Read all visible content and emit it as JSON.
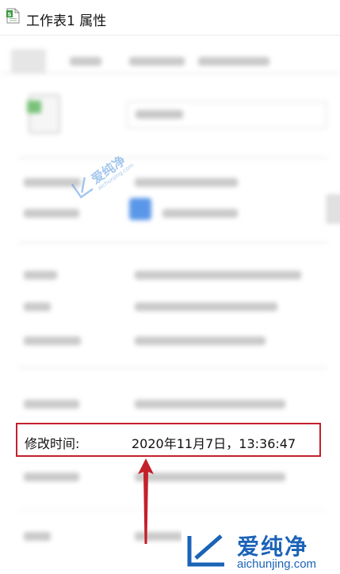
{
  "window": {
    "title": "工作表1 属性",
    "icon": "spreadsheet-file-icon"
  },
  "highlighted_row": {
    "label": "修改时间:",
    "value": "2020年11月7日，13:36:47"
  },
  "watermark": {
    "brand_cn": "爱纯净",
    "brand_url": "aichunjing.com"
  },
  "colors": {
    "highlight_border": "#c4202b",
    "arrow": "#c4202b",
    "watermark": "#1b63b8",
    "accent_chip": "#5b97e8"
  }
}
